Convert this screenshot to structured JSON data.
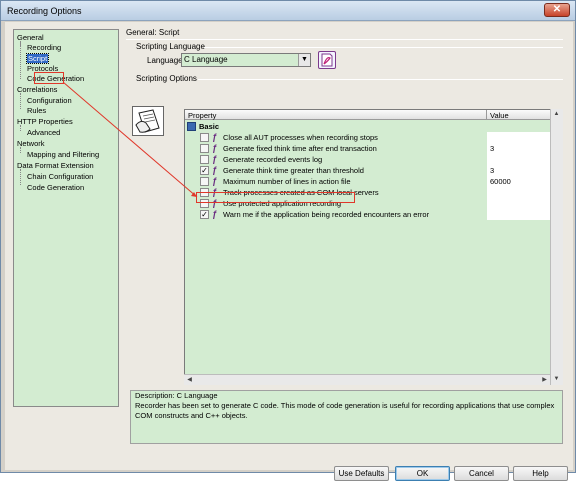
{
  "window": {
    "title": "Recording Options",
    "close_glyph": "✕"
  },
  "nav": {
    "items": [
      {
        "label": "General",
        "level": 0
      },
      {
        "label": "Recording",
        "level": 1
      },
      {
        "label": "Script",
        "level": 1,
        "selected": true
      },
      {
        "label": "Protocols",
        "level": 1
      },
      {
        "label": "Code Generation",
        "level": 1
      },
      {
        "label": "Correlations",
        "level": 0
      },
      {
        "label": "Configuration",
        "level": 1
      },
      {
        "label": "Rules",
        "level": 1
      },
      {
        "label": "HTTP Properties",
        "level": 0
      },
      {
        "label": "Advanced",
        "level": 1
      },
      {
        "label": "Network",
        "level": 0
      },
      {
        "label": "Mapping and Filtering",
        "level": 1
      },
      {
        "label": "Data Format Extension",
        "level": 0
      },
      {
        "label": "Chain Configuration",
        "level": 1
      },
      {
        "label": "Code Generation",
        "level": 1
      }
    ]
  },
  "content": {
    "section_title": "General: Script",
    "scripting_language": {
      "group_label": "Scripting Language",
      "field_label": "Language:",
      "value": "C Language",
      "dropdown_glyph": "▼"
    },
    "scripting_options": {
      "group_label": "Scripting Options",
      "columns": {
        "property": "Property",
        "value": "Value"
      },
      "section": "Basic",
      "rows": [
        {
          "label": "Close all AUT processes when recording stops",
          "checked": false,
          "value": ""
        },
        {
          "label": "Generate fixed think time after end transaction",
          "checked": false,
          "value": "3"
        },
        {
          "label": "Generate recorded events log",
          "checked": false,
          "value": ""
        },
        {
          "label": "Generate think time greater than threshold",
          "checked": true,
          "value": "3"
        },
        {
          "label": "Maximum number of lines in action file",
          "checked": false,
          "value": "60000"
        },
        {
          "label": "Track processes created as COM local servers",
          "checked": false,
          "value": ""
        },
        {
          "label": "Use protected application recording",
          "checked": false,
          "value": ""
        },
        {
          "label": "Warn me if the application being recorded encounters an error",
          "checked": true,
          "value": ""
        }
      ],
      "check_glyph": "✓",
      "quill_glyph": "ƒ"
    },
    "description": {
      "title": "Description: C Language",
      "text": "Recorder has been set to generate C code.  This mode of code generation is useful for recording applications that use complex COM constructs and C++ objects."
    }
  },
  "buttons": {
    "use_defaults": "Use Defaults",
    "ok": "OK",
    "cancel": "Cancel",
    "help": "Help"
  },
  "colors": {
    "panel_green": "#d3ecd1",
    "selection_blue": "#3169c6",
    "annotation_red": "#e0372a"
  }
}
